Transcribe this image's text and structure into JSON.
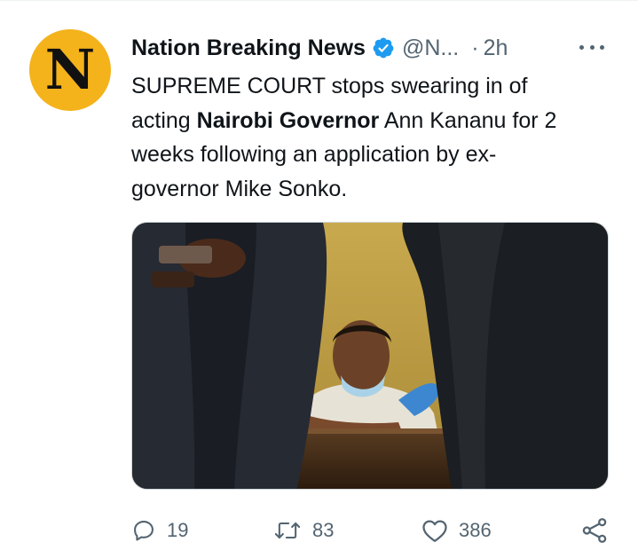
{
  "tweet": {
    "author_name": "Nation Breaking News",
    "handle": "@N...",
    "dot": "·",
    "time": "2h",
    "avatar_letter": "N",
    "avatar_color": "#f4b21b",
    "verified": true,
    "text_lines": [
      [
        "SUPREME COURT stops swearing in of",
        ""
      ],
      [
        "acting ",
        "Nairobi Governor",
        " Ann Kananu for 2"
      ],
      [
        "weeks following an application by ex-"
      ],
      [
        "governor Mike Sonko."
      ]
    ],
    "text_parts": {
      "l1": "SUPREME COURT stops swearing in of",
      "l2a": "acting ",
      "l2b": "Nairobi Governor",
      "l2c": " Ann Kananu for 2",
      "l3": "weeks following an application by ex-",
      "l4": "governor Mike Sonko."
    },
    "image": "photo of a man wearing a lowered face mask seated at a courtroom bench between people in dark suits",
    "actions": {
      "replies": "19",
      "retweets": "83",
      "likes": "386"
    },
    "accent_color": "#1d9bf0",
    "muted_color": "#536471"
  }
}
